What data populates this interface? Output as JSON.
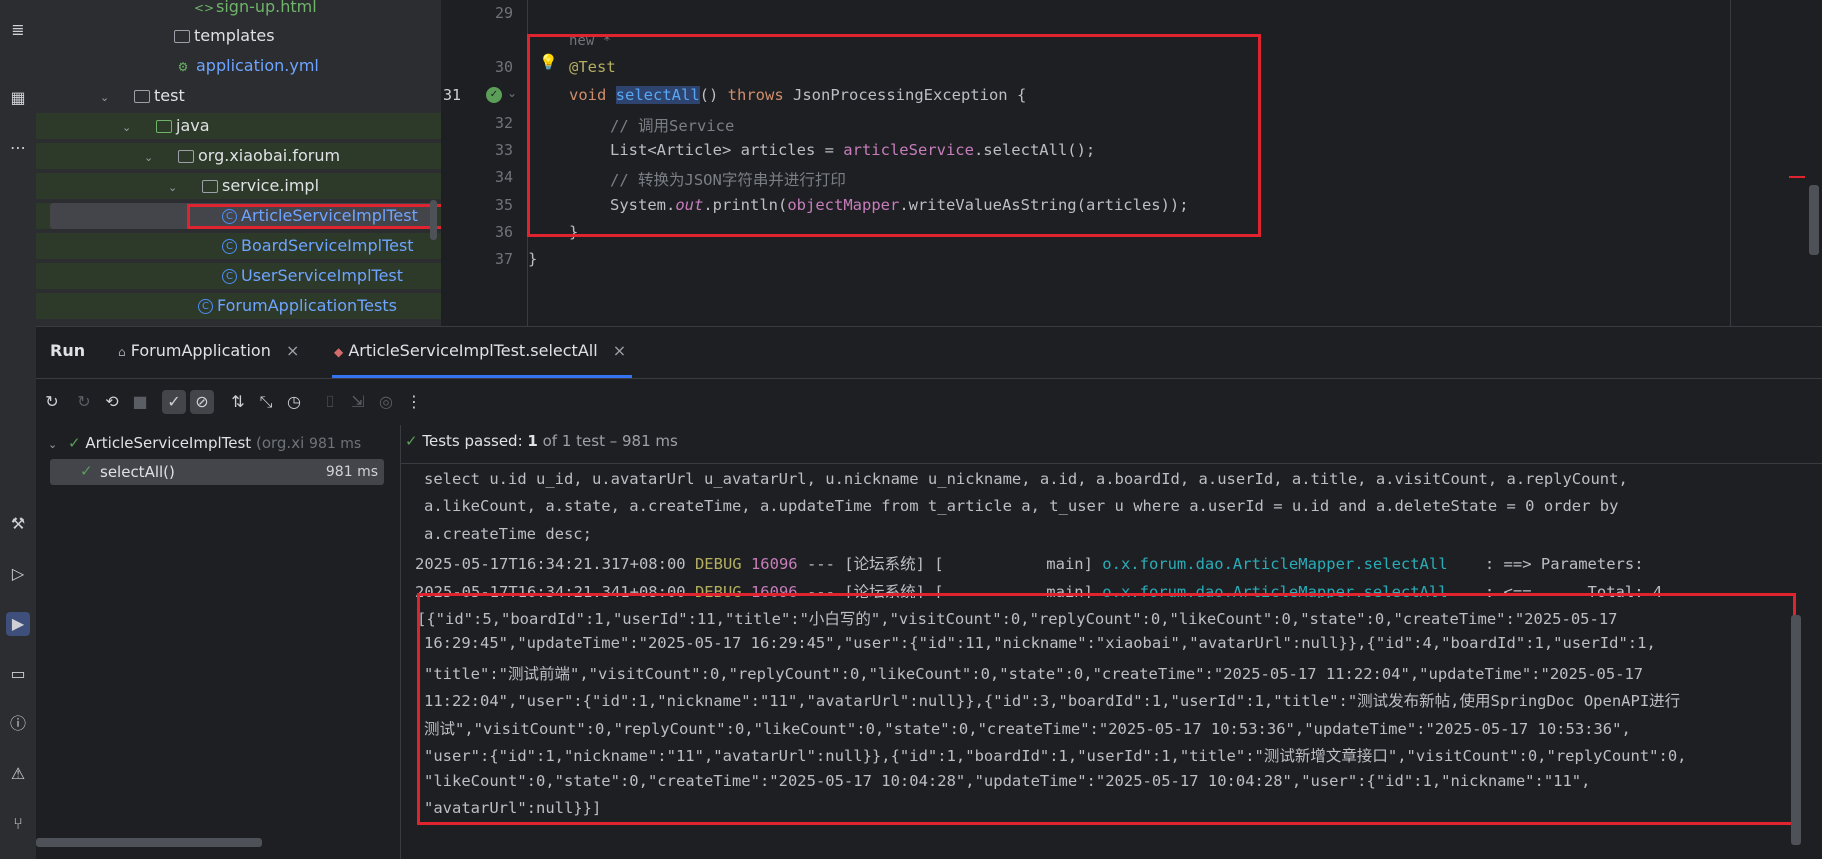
{
  "project_tree": {
    "items": [
      {
        "label": "sign-up.html",
        "kind": "html"
      },
      {
        "label": "templates",
        "kind": "folder"
      },
      {
        "label": "application.yml",
        "kind": "yml"
      },
      {
        "label": "test",
        "kind": "folder"
      },
      {
        "label": "java",
        "kind": "folder"
      },
      {
        "label": "org.xiaobai.forum",
        "kind": "package"
      },
      {
        "label": "service.impl",
        "kind": "package"
      },
      {
        "label": "ArticleServiceImplTest",
        "kind": "class"
      },
      {
        "label": "BoardServiceImplTest",
        "kind": "class"
      },
      {
        "label": "UserServiceImplTest",
        "kind": "class"
      },
      {
        "label": "ForumApplicationTests",
        "kind": "class"
      }
    ]
  },
  "editor": {
    "line_numbers": [
      "29",
      "30",
      "31",
      "32",
      "33",
      "34",
      "35",
      "36",
      "37"
    ],
    "usage_hint": "new *",
    "lines": {
      "l30_annotation": "@Test",
      "l31_void": "void ",
      "l31_method": "selectAll",
      "l31_params": "() ",
      "l31_throws": "throws",
      "l31_rest": " JsonProcessingException {",
      "l32_comment": "// 调用Service",
      "l33_type": "List<Article> articles = ",
      "l33_field": "articleService",
      "l33_call": ".selectAll();",
      "l34_comment": "// 转换为JSON字符串并进行打印",
      "l35_sys": "System.",
      "l35_out": "out",
      "l35_println": ".println(",
      "l35_field": "objectMapper",
      "l35_end": ".writeValueAsString(articles));",
      "l36": "}",
      "l37": "}"
    }
  },
  "run": {
    "title": "Run",
    "tabs": [
      "ForumApplication",
      "ArticleServiceImplTest.selectAll"
    ],
    "test_tree": {
      "root_label": "ArticleServiceImplTest",
      "root_pkg": "(org.xi",
      "root_time": "981 ms",
      "child_label": "selectAll()",
      "child_time": "981 ms"
    },
    "status": {
      "prefix": "Tests passed: ",
      "count": "1",
      "suffix": "of 1 test – 981 ms"
    },
    "console": {
      "sql_lines": [
        "select u.id u_id, u.avatarUrl u_avatarUrl, u.nickname u_nickname, a.id, a.boardId, a.userId, a.title, a.visitCount, a.replyCount,",
        "a.likeCount, a.state, a.createTime, a.updateTime from t_article a, t_user u where a.userId = u.id and a.deleteState = 0 order by",
        "a.createTime desc;"
      ],
      "log1": {
        "ts": "2025-05-17T16:34:21.317+08:00 ",
        "level": "DEBUG",
        "pid": " 16096",
        "mid": " --- [论坛系统] [           main] ",
        "logger": "o.x.forum.dao.ArticleMapper.selectAll",
        "msg": "    : ==> Parameters:"
      },
      "log2": {
        "ts": "2025-05-17T16:34:21.341+08:00 ",
        "level": "DEBUG",
        "pid": " 16096",
        "mid": " --- [论坛系统] [           main] ",
        "logger": "o.x.forum.dao.ArticleMapper.selectAll",
        "msg": "    : <==      Total: 4"
      },
      "json_lines": [
        "[{\"id\":5,\"boardId\":1,\"userId\":11,\"title\":\"小白写的\",\"visitCount\":0,\"replyCount\":0,\"likeCount\":0,\"state\":0,\"createTime\":\"2025-05-17",
        "16:29:45\",\"updateTime\":\"2025-05-17 16:29:45\",\"user\":{\"id\":11,\"nickname\":\"xiaobai\",\"avatarUrl\":null}},{\"id\":4,\"boardId\":1,\"userId\":1,",
        "\"title\":\"测试前端\",\"visitCount\":0,\"replyCount\":0,\"likeCount\":0,\"state\":0,\"createTime\":\"2025-05-17 11:22:04\",\"updateTime\":\"2025-05-17",
        "11:22:04\",\"user\":{\"id\":1,\"nickname\":\"11\",\"avatarUrl\":null}},{\"id\":3,\"boardId\":1,\"userId\":1,\"title\":\"测试发布新帖,使用SpringDoc OpenAPI进行",
        "测试\",\"visitCount\":0,\"replyCount\":0,\"likeCount\":0,\"state\":0,\"createTime\":\"2025-05-17 10:53:36\",\"updateTime\":\"2025-05-17 10:53:36\",",
        "\"user\":{\"id\":1,\"nickname\":\"11\",\"avatarUrl\":null}},{\"id\":1,\"boardId\":1,\"userId\":1,\"title\":\"测试新增文章接口\",\"visitCount\":0,\"replyCount\":0,",
        "\"likeCount\":0,\"state\":0,\"createTime\":\"2025-05-17 10:04:28\",\"updateTime\":\"2025-05-17 10:04:28\",\"user\":{\"id\":1,\"nickname\":\"11\",",
        "\"avatarUrl\":null}}]"
      ]
    }
  }
}
